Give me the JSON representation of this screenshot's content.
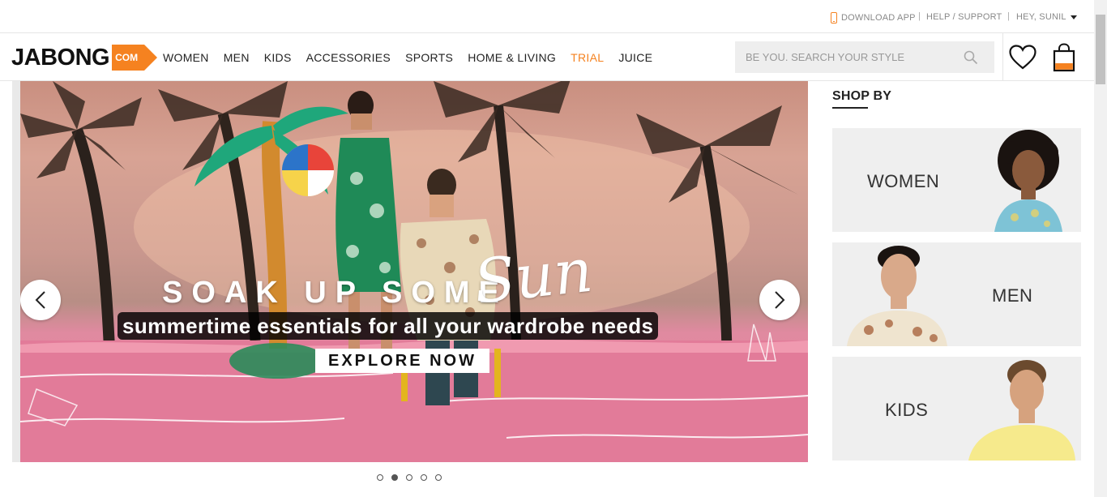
{
  "topbar": {
    "download_app": "DOWNLOAD APP",
    "help_support": "HELP / SUPPORT",
    "user_greeting": "HEY, SUNIL",
    "separator": "|"
  },
  "header": {
    "logo_text": "JABONG",
    "logo_suffix": "COM",
    "nav": [
      {
        "label": "WOMEN"
      },
      {
        "label": "MEN"
      },
      {
        "label": "KIDS"
      },
      {
        "label": "ACCESSORIES"
      },
      {
        "label": "SPORTS"
      },
      {
        "label": "HOME & LIVING"
      },
      {
        "label": "TRIAL"
      },
      {
        "label": "JUICE"
      }
    ],
    "search_placeholder": "BE YOU. SEARCH YOUR STYLE",
    "icons": [
      "search-icon",
      "heart-icon",
      "shopping-bag-icon"
    ]
  },
  "hero": {
    "title": "SOAK UP SOME",
    "script_word": "Sun",
    "subtitle": "summertime essentials for all your wardrobe needs",
    "cta": "EXPLORE NOW",
    "slide_count": 5,
    "active_slide": 2
  },
  "shop_by": {
    "heading": "SHOP BY",
    "categories": [
      {
        "label": "WOMEN"
      },
      {
        "label": "MEN"
      },
      {
        "label": "KIDS"
      }
    ]
  },
  "colors": {
    "accent": "#f58220",
    "text": "#222222",
    "card_bg": "#efefef"
  }
}
